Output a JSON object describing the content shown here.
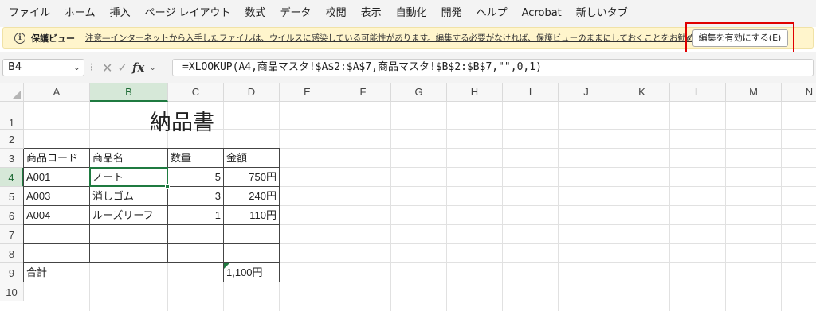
{
  "menu": [
    "ファイル",
    "ホーム",
    "挿入",
    "ページ レイアウト",
    "数式",
    "データ",
    "校閲",
    "表示",
    "自動化",
    "開発",
    "ヘルプ",
    "Acrobat",
    "新しいタブ"
  ],
  "protected_view": {
    "title": "保護ビュー",
    "message": "注意—インターネットから入手したファイルは、ウイルスに感染している可能性があります。編集する必要がなければ、保護ビューのままにしておくことをお勧めします。",
    "enable_button": "編集を有効にする(E)",
    "highlight_color": "#e00000"
  },
  "formula_bar": {
    "name_box": "B4",
    "formula": "=XLOOKUP(A4,商品マスタ!$A$2:$A$7,商品マスタ!$B$2:$B$7,\"\",0,1)"
  },
  "grid": {
    "columns": [
      "A",
      "B",
      "C",
      "D",
      "E",
      "F",
      "G",
      "H",
      "I",
      "J",
      "K",
      "L",
      "M",
      "N"
    ],
    "rows": [
      "1",
      "2",
      "3",
      "4",
      "5",
      "6",
      "7",
      "8",
      "9",
      "10"
    ],
    "selected_cell": "B4",
    "accent_color": "#1f7a40"
  },
  "sheet": {
    "title": "納品書",
    "headers": [
      "商品コード",
      "商品名",
      "数量",
      "金額"
    ],
    "rows": [
      {
        "code": "A001",
        "name": "ノート",
        "qty": "5",
        "amount": "750円"
      },
      {
        "code": "A003",
        "name": "消しゴム",
        "qty": "3",
        "amount": "240円"
      },
      {
        "code": "A004",
        "name": "ルーズリーフ",
        "qty": "1",
        "amount": "110円"
      }
    ],
    "total_label": "合計",
    "total_value": "1,100円"
  }
}
